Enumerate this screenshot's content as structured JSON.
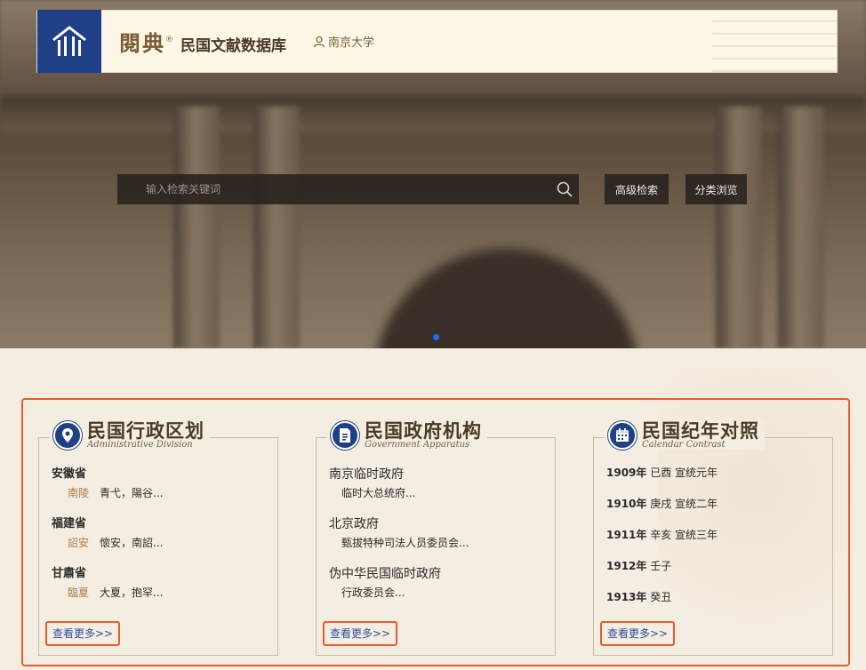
{
  "header": {
    "logo_icon": "library-building-icon",
    "brand_calligraphy": "閱典",
    "brand_reg": "®",
    "brand_name": "民国文献数据库",
    "user_icon": "user-icon",
    "user_name": "南京大学"
  },
  "search": {
    "placeholder": "输入检索关键词",
    "icon": "search-icon",
    "advanced_label": "高级检索",
    "browse_label": "分类浏览"
  },
  "colors": {
    "brand_blue": "#1f3f86",
    "highlight_red": "#ec5a30",
    "link_blue": "#2c4fa0",
    "accent_brown": "#b07a45"
  },
  "panels": [
    {
      "icon": "location-pin-icon",
      "title": "民国行政区划",
      "subtitle": "Administrative Division",
      "groups": [
        {
          "title": "安徽省",
          "sub": "南陵",
          "detail": "青弋，陽谷..."
        },
        {
          "title": "福建省",
          "sub": "詔安",
          "detail": "懷安，南詔..."
        },
        {
          "title": "甘肅省",
          "sub": "臨夏",
          "detail": "大夏，抱罕..."
        }
      ],
      "more": "查看更多>>"
    },
    {
      "icon": "document-icon",
      "title": "民国政府机构",
      "subtitle": "Government Apparatus",
      "groups": [
        {
          "title": "南京临时政府",
          "detail": "临时大总统府..."
        },
        {
          "title": "北京政府",
          "detail": "甄拔特种司法人员委员会..."
        },
        {
          "title": "伪中华民国临时政府",
          "detail": "行政委员会..."
        }
      ],
      "more": "查看更多>>"
    },
    {
      "icon": "calendar-icon",
      "title": "民国纪年对照",
      "subtitle": "Calendar Contrast",
      "years": [
        {
          "year": "1909年",
          "text": "已酉 宣统元年"
        },
        {
          "year": "1910年",
          "text": "庚戌 宣统二年"
        },
        {
          "year": "1911年",
          "text": "辛亥 宣统三年"
        },
        {
          "year": "1912年",
          "text": "壬子"
        },
        {
          "year": "1913年",
          "text": "癸丑"
        }
      ],
      "more": "查看更多>>"
    }
  ]
}
